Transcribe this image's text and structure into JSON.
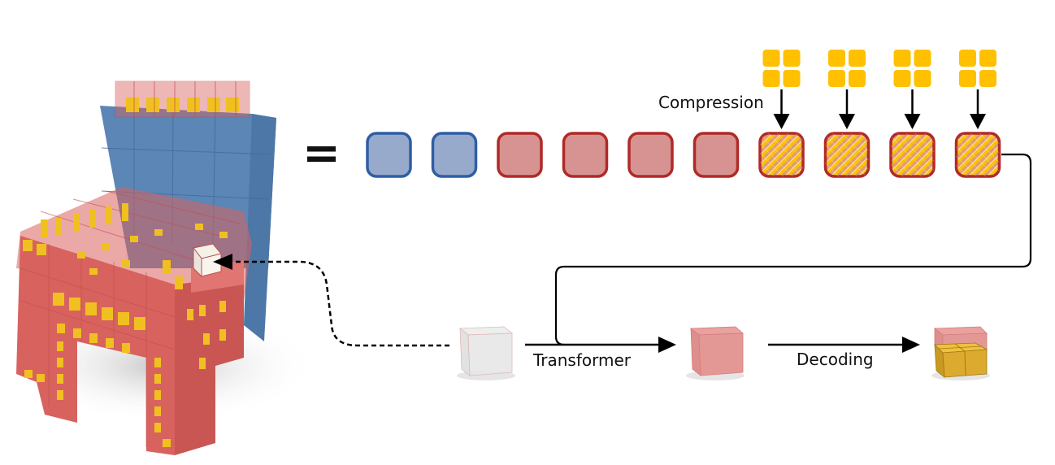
{
  "labels": {
    "equals": "=",
    "compression": "Compression",
    "transformer": "Transformer",
    "decoding": "Decoding"
  },
  "tokens": [
    {
      "kind": "filled",
      "group": "blue"
    },
    {
      "kind": "filled",
      "group": "blue"
    },
    {
      "kind": "filled",
      "group": "red"
    },
    {
      "kind": "filled",
      "group": "red"
    },
    {
      "kind": "filled",
      "group": "red"
    },
    {
      "kind": "filled",
      "group": "red"
    },
    {
      "kind": "compressed",
      "group": "red"
    },
    {
      "kind": "compressed",
      "group": "red"
    },
    {
      "kind": "compressed",
      "group": "red"
    },
    {
      "kind": "compressed",
      "group": "red"
    }
  ],
  "colors": {
    "blue_fill": "#98aacc",
    "blue_stroke": "#2f5ea3",
    "red_fill": "#d69391",
    "red_stroke": "#b02a28",
    "yellow": "#ffc000",
    "arrow": "#000000",
    "chair_blue": "#5b86b5",
    "chair_red": "#d8625e",
    "chair_yellow": "#f0c020"
  },
  "stages": [
    "empty-cube",
    "predicted-red-cube",
    "decoded-cube-with-subcubes"
  ]
}
